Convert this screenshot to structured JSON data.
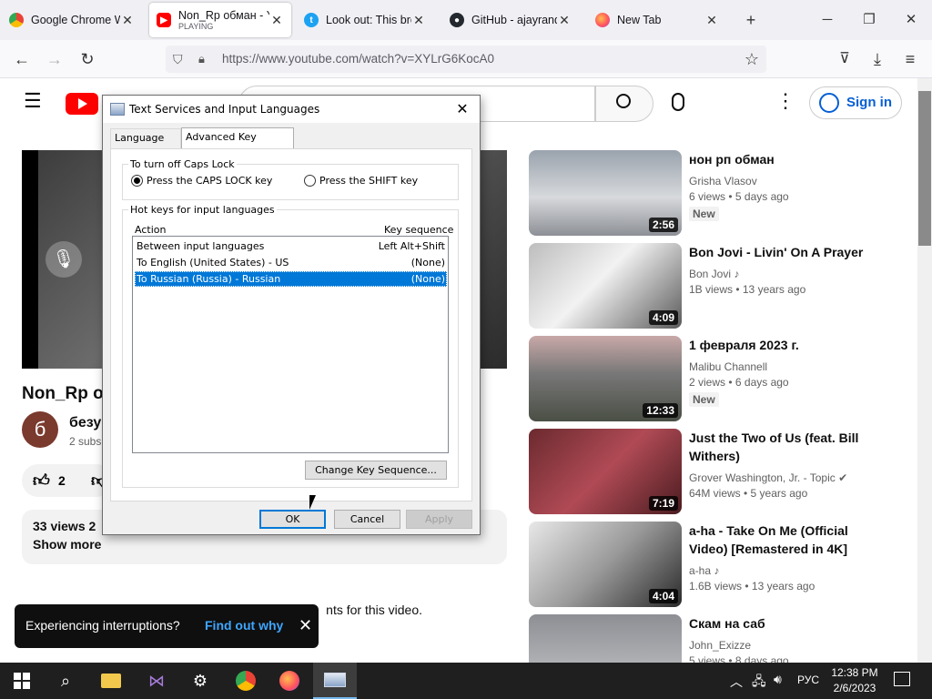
{
  "browser": {
    "tabs": [
      {
        "title": "Google Chrome We",
        "subtitle": "",
        "icon": "chrome-icon",
        "active": false
      },
      {
        "title": "Non_Rp обман - Y",
        "subtitle": "PLAYING",
        "icon": "youtube-icon",
        "active": true
      },
      {
        "title": "Look out: This brow",
        "subtitle": "",
        "icon": "t-icon",
        "active": false
      },
      {
        "title": "GitHub - ajayrandh",
        "subtitle": "",
        "icon": "github-icon",
        "active": false
      },
      {
        "title": "New Tab",
        "subtitle": "",
        "icon": "firefox-icon",
        "active": false
      }
    ],
    "url": "https://www.youtube.com/watch?v=XYLrG6KocA0",
    "new_tab_glyph": "+",
    "window_controls": {
      "minimize": "─",
      "maximize": "❐",
      "close": "✕"
    }
  },
  "youtube": {
    "logo_text": "Y",
    "sign_in": "Sign in",
    "video": {
      "title": "Non_Rp о",
      "channel_initial": "б",
      "channel_name": "безу",
      "channel_subs": "2 subs",
      "likes": "2",
      "views_line": "33 views  2",
      "show_more": "Show more",
      "comments_note": "nts for this video."
    },
    "toast": {
      "message": "Experiencing interruptions?",
      "link": "Find out why",
      "close": "✕"
    },
    "recommendations": [
      {
        "title": "нон рп обман",
        "channel": "Grisha Vlasov",
        "meta": "6 views • 5 days ago",
        "badge": "New",
        "duration": "2:56",
        "verified": false,
        "music": false
      },
      {
        "title": "Bon Jovi - Livin' On A Prayer",
        "channel": "Bon Jovi",
        "meta": "1B views • 13 years ago",
        "badge": "",
        "duration": "4:09",
        "verified": false,
        "music": true
      },
      {
        "title": "1 февраля 2023 г.",
        "channel": "Malibu Channell",
        "meta": "2 views • 6 days ago",
        "badge": "New",
        "duration": "12:33",
        "verified": false,
        "music": false
      },
      {
        "title": "Just the Two of Us (feat. Bill Withers)",
        "channel": "Grover Washington, Jr. - Topic",
        "meta": "64M views • 5 years ago",
        "badge": "",
        "duration": "7:19",
        "verified": true,
        "music": false
      },
      {
        "title": "a-ha - Take On Me (Official Video) [Remastered in 4K]",
        "channel": "a-ha",
        "meta": "1.6B views • 13 years ago",
        "badge": "",
        "duration": "4:04",
        "verified": false,
        "music": true
      },
      {
        "title": "Скам на саб",
        "channel": "John_Exizze",
        "meta": "5 views • 8 days ago",
        "badge": "",
        "duration": "",
        "verified": false,
        "music": false
      }
    ]
  },
  "dialog": {
    "title": "Text Services and Input Languages",
    "tabs": [
      "Language Bar",
      "Advanced Key Settings"
    ],
    "active_tab": "Advanced Key Settings",
    "caps_group": {
      "legend": "To turn off Caps Lock",
      "option_caps": "Press the CAPS LOCK key",
      "option_shift": "Press the SHIFT key",
      "selected": "caps"
    },
    "hotkeys_group": {
      "legend": "Hot keys for input languages",
      "col_action": "Action",
      "col_key": "Key sequence",
      "rows": [
        {
          "action": "Between input languages",
          "key": "Left Alt+Shift",
          "selected": false
        },
        {
          "action": "To English (United States) - US",
          "key": "(None)",
          "selected": false
        },
        {
          "action": "To Russian (Russia) - Russian",
          "key": "(None)",
          "selected": true
        }
      ]
    },
    "change_button": "Change Key Sequence...",
    "ok": "OK",
    "cancel": "Cancel",
    "apply": "Apply"
  },
  "taskbar": {
    "tray_language": "РУС",
    "time": "12:38 PM",
    "date": "2/6/2023"
  }
}
